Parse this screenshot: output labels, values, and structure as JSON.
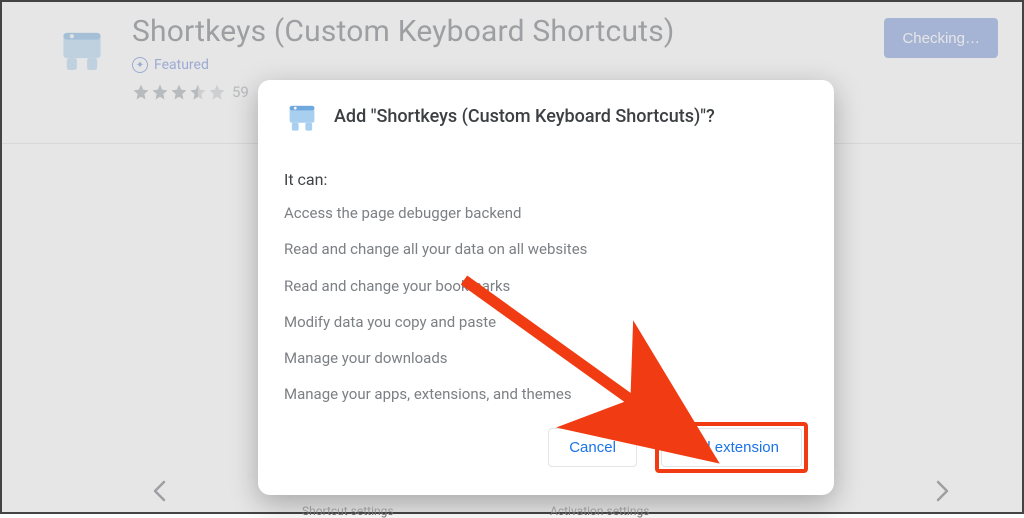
{
  "header": {
    "title": "Shortkeys (Custom Keyboard Shortcuts)",
    "featured_label": "Featured",
    "rating_count": "59",
    "checking_label": "Checking…"
  },
  "carousel": {
    "caption1": "Shortcut settings",
    "caption2": "Activation settings"
  },
  "modal": {
    "title": "Add \"Shortkeys (Custom Keyboard Shortcuts)\"?",
    "it_can_label": "It can:",
    "permissions": [
      "Access the page debugger backend",
      "Read and change all your data on all websites",
      "Read and change your bookmarks",
      "Modify data you copy and paste",
      "Manage your downloads",
      "Manage your apps, extensions, and themes"
    ],
    "cancel_label": "Cancel",
    "add_label": "Add extension"
  },
  "colors": {
    "accent": "#1a73e8",
    "annotation": "#f13b12"
  }
}
